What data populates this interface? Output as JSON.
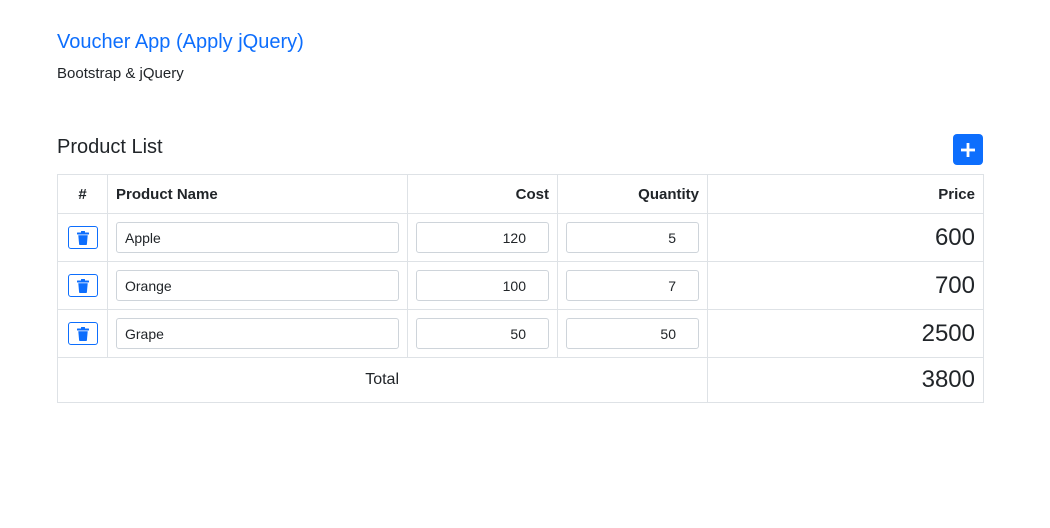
{
  "header": {
    "title": "Voucher App (Apply jQuery)",
    "subtitle": "Bootstrap & jQuery"
  },
  "product_list": {
    "title": "Product List",
    "add_button_icon": "plus-icon",
    "columns": [
      "#",
      "Product Name",
      "Cost",
      "Quantity",
      "Price"
    ],
    "rows": [
      {
        "name": "Apple",
        "cost": "120",
        "quantity": "5",
        "price": "600"
      },
      {
        "name": "Orange",
        "cost": "100",
        "quantity": "7",
        "price": "700"
      },
      {
        "name": "Grape",
        "cost": "50",
        "quantity": "50",
        "price": "2500"
      }
    ],
    "delete_icon": "trash-icon",
    "total_label": "Total",
    "total_value": "3800"
  },
  "colors": {
    "primary": "#0d6efd",
    "border": "#dee2e6",
    "text": "#212529"
  }
}
